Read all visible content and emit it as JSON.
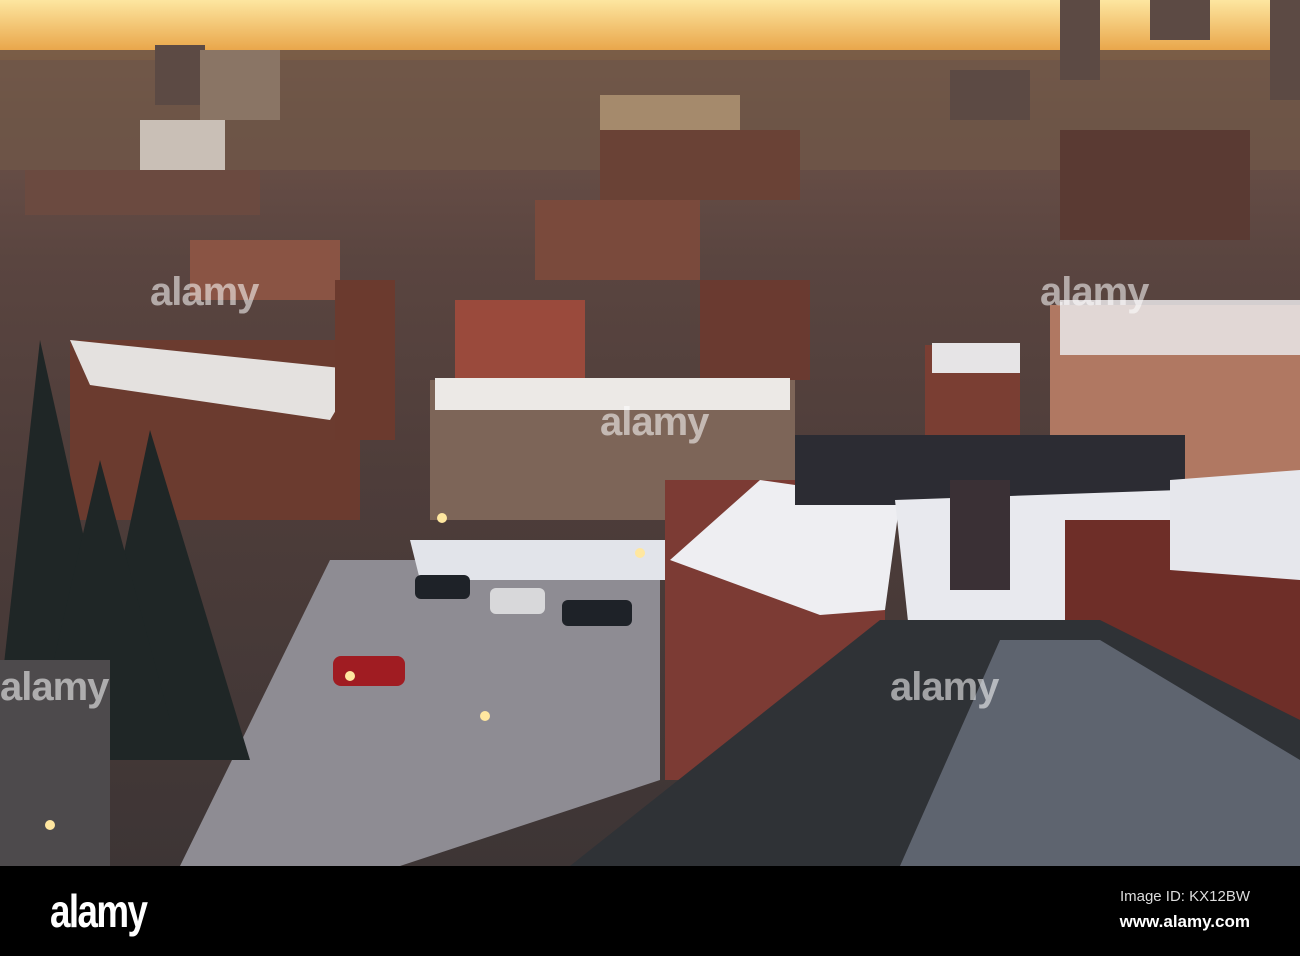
{
  "photo": {
    "description_alt": "Snowy city rooftops at sunset"
  },
  "watermark": {
    "text": "alamy"
  },
  "footer": {
    "logo": "alamy",
    "image_id": "Image ID: KX12BW",
    "url": "www.alamy.com"
  }
}
